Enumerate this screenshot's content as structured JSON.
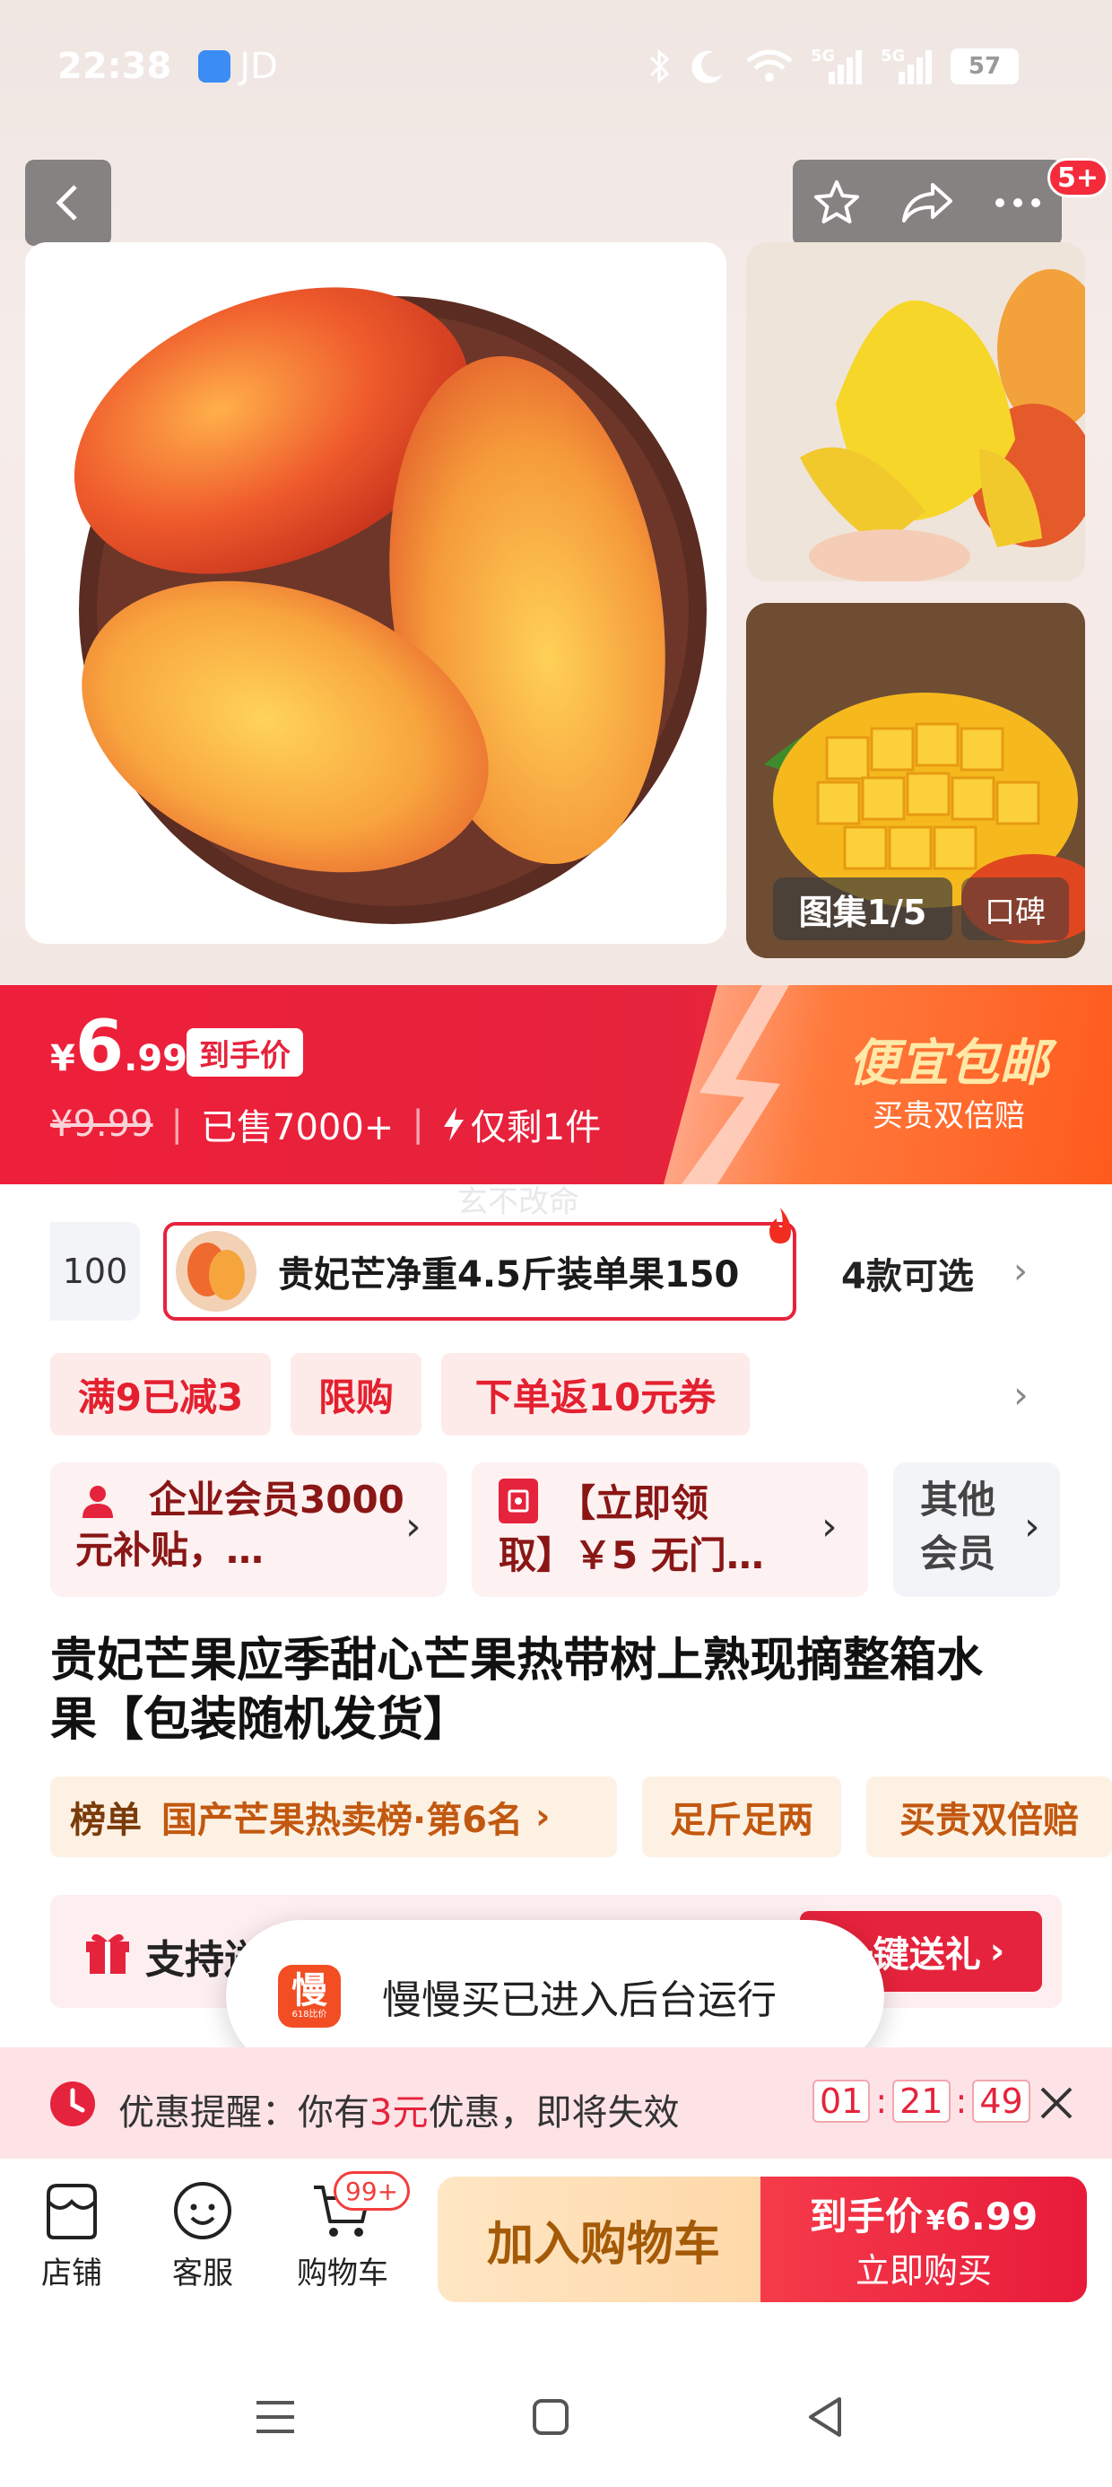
{
  "status_bar": {
    "time": "22:38",
    "app": "JD",
    "battery": "57",
    "signal1": "5G",
    "signal2": "5G"
  },
  "header": {
    "notification_badge": "5+"
  },
  "gallery": {
    "counter": "图集1/5",
    "reviews_label": "口碑"
  },
  "price": {
    "currency": "¥",
    "integer": "6",
    "decimal": ".99",
    "final_tag": "到手价",
    "original": "¥9.99",
    "sold": "已售7000+",
    "stock": "仅剩1件",
    "promo_title": "便宜包邮",
    "promo_sub": "买贵双倍赔",
    "watermark": "玄不改命"
  },
  "variants": {
    "prev_value": "100",
    "selected": "贵妃芒净重4.5斤装单果150",
    "count": "4款可选"
  },
  "coupons": [
    "满9已减3",
    "限购",
    "下单返10元券"
  ],
  "benefits": {
    "enterprise": "企业会员3000元补贴，…",
    "voucher_line1": "【立即领",
    "voucher_line2": "取】￥5 无门…",
    "other_line1": "其他",
    "other_line2": "会员"
  },
  "product": {
    "title_line1": "贵妃芒果应季甜心芒果热带树上熟现摘整箱水",
    "title_line2": "果【包装随机发货】"
  },
  "tags": {
    "rank_label": "榜单",
    "rank_text": "国产芒果热卖榜·第6名",
    "tag2": "足斤足两",
    "tag3": "买贵双倍赔"
  },
  "gift": {
    "label": "支持送",
    "button": "一键送礼"
  },
  "toast": {
    "app_icon_text": "慢",
    "app_icon_sub": "618比价",
    "message": "慢慢买已进入后台运行"
  },
  "reminder": {
    "label": "优惠提醒：你有",
    "amount": "3元",
    "suffix": "优惠，即将失效",
    "h": "01",
    "m": "21",
    "s": "49"
  },
  "bottom_nav": {
    "store": "店铺",
    "service": "客服",
    "cart": "购物车",
    "cart_badge": "99+",
    "add_cart": "加入购物车",
    "buy_price_label": "到手价",
    "buy_price_currency": "¥",
    "buy_price_value": "6.99",
    "buy_now": "立即购买"
  },
  "colors": {
    "brand_red": "#e6233c",
    "orange": "#ff5a1e",
    "tag_orange": "#c2580f"
  }
}
